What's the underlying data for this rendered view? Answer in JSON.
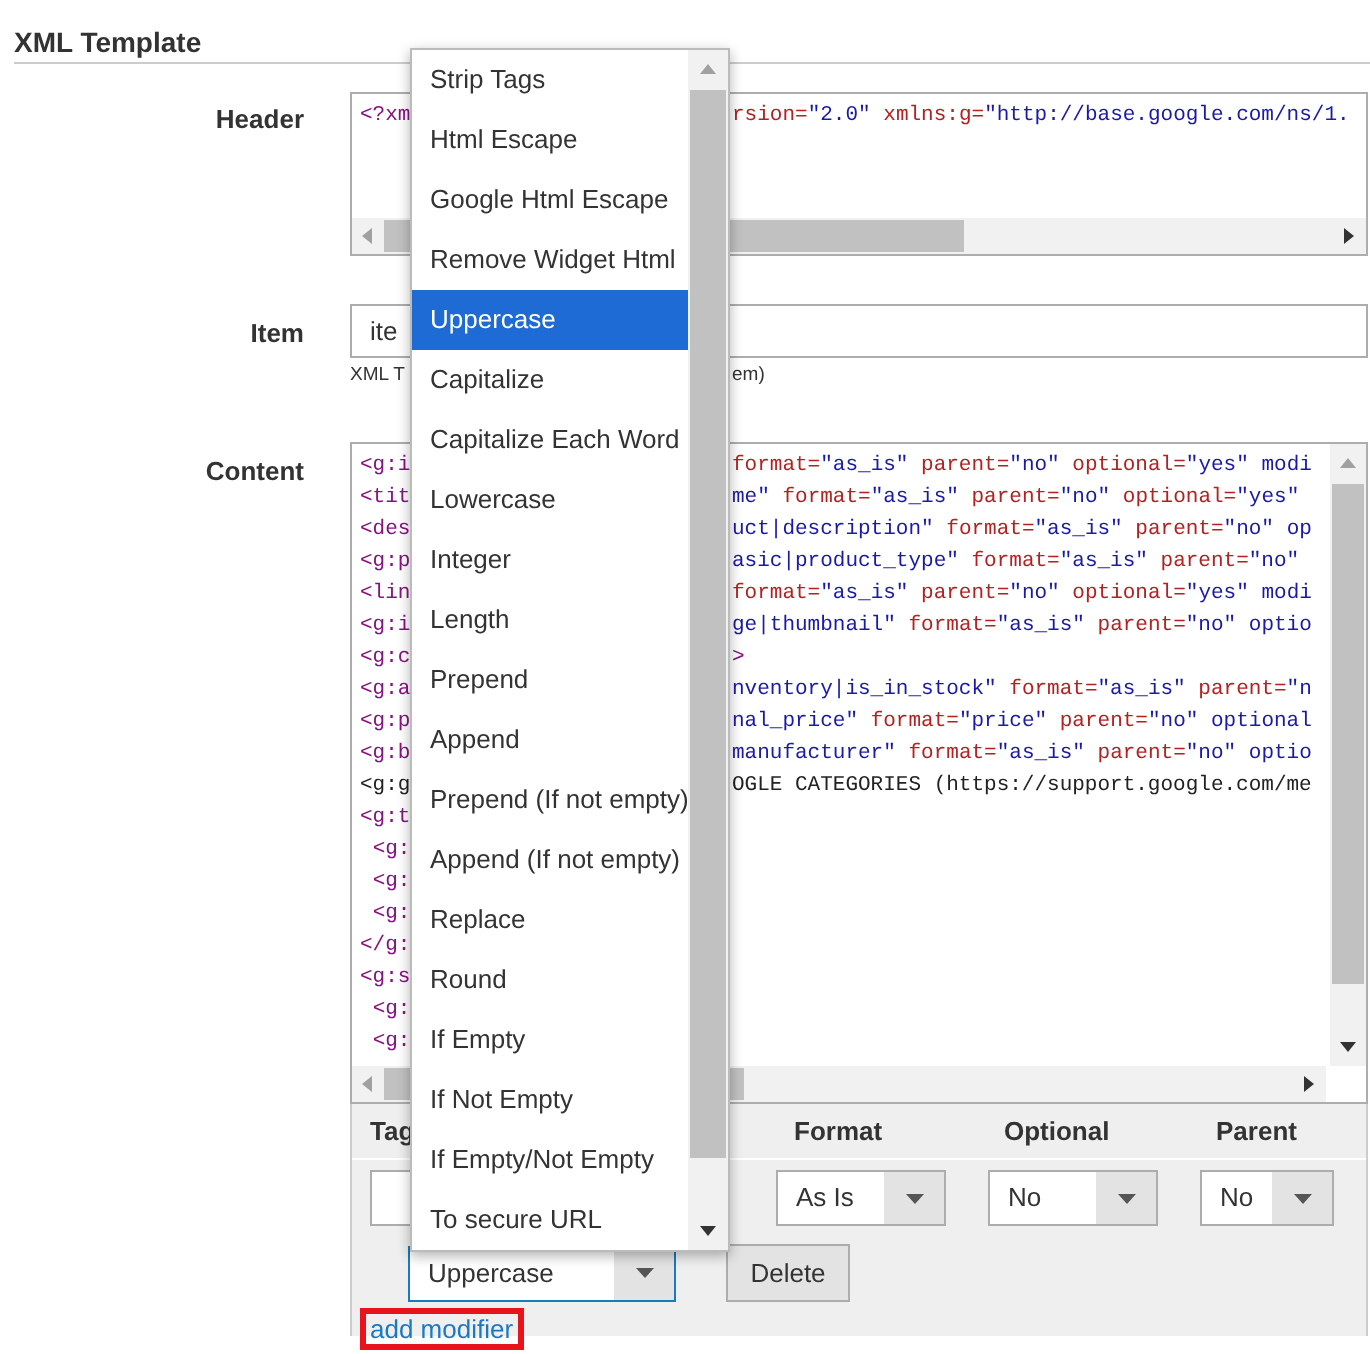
{
  "section": {
    "title": "XML Template"
  },
  "header_field": {
    "label": "Header",
    "line": {
      "left": "<?xm",
      "right": "rsion=\"2.0\" xmlns:g=\"http://base.google.com/ns/1."
    }
  },
  "item_field": {
    "label": "Item",
    "value": "ite",
    "hint_left": "XML T",
    "hint_right": "em)"
  },
  "content_field": {
    "label": "Content",
    "lines": [
      {
        "kind": "code",
        "left": "<g:i",
        "right": "format=\"as_is\" parent=\"no\" optional=\"yes\" modi"
      },
      {
        "kind": "code",
        "left": "<tit",
        "right": "me\" format=\"as_is\" parent=\"no\" optional=\"yes\""
      },
      {
        "kind": "code",
        "left": "<des",
        "right": "uct|description\" format=\"as_is\" parent=\"no\" op"
      },
      {
        "kind": "code",
        "left": "<g:p",
        "right": "asic|product_type\" format=\"as_is\" parent=\"no\""
      },
      {
        "kind": "code",
        "left": "<lin",
        "right": "format=\"as_is\" parent=\"no\" optional=\"yes\" modi"
      },
      {
        "kind": "code",
        "left": "<g:i",
        "right": "ge|thumbnail\" format=\"as_is\" parent=\"no\" optio"
      },
      {
        "kind": "code",
        "left": "<g:c",
        "right": ">"
      },
      {
        "kind": "code",
        "left": "<g:a",
        "right": "nventory|is_in_stock\" format=\"as_is\" parent=\"n"
      },
      {
        "kind": "code",
        "left": "<g:p",
        "right": "nal_price\" format=\"price\" parent=\"no\" optional"
      },
      {
        "kind": "code",
        "left": "<g:b",
        "right": "manufacturer\" format=\"as_is\" parent=\"no\" optio"
      },
      {
        "kind": "comment",
        "left": "<g:g",
        "right": "OGLE CATEGORIES (https://support.google.com/me"
      },
      {
        "kind": "code",
        "left": "<g:t"
      },
      {
        "kind": "code",
        "left": " <g:"
      },
      {
        "kind": "code",
        "left": " <g:"
      },
      {
        "kind": "code",
        "left": " <g:"
      },
      {
        "kind": "code",
        "left": "</g:"
      },
      {
        "kind": "code",
        "left": "<g:s"
      },
      {
        "kind": "code",
        "left": " <g:"
      },
      {
        "kind": "code",
        "left": " <g:"
      }
    ]
  },
  "fields_table": {
    "columns": [
      "Tag",
      "Format",
      "Optional",
      "Parent"
    ],
    "row": {
      "format": "As Is",
      "optional": "No",
      "parent": "No"
    },
    "modifier": {
      "value": "Uppercase",
      "focused": true
    },
    "delete_button": "Delete",
    "add_modifier_link": {
      "label": "add modifier",
      "highlighted": true
    }
  },
  "modifier_dropdown": {
    "items": [
      {
        "label": "Strip Tags",
        "selected": false
      },
      {
        "label": "Html Escape",
        "selected": false
      },
      {
        "label": "Google Html Escape",
        "selected": false
      },
      {
        "label": "Remove Widget Html",
        "selected": false
      },
      {
        "label": "Uppercase",
        "selected": true
      },
      {
        "label": "Capitalize",
        "selected": false
      },
      {
        "label": "Capitalize Each Word",
        "selected": false
      },
      {
        "label": "Lowercase",
        "selected": false
      },
      {
        "label": "Integer",
        "selected": false
      },
      {
        "label": "Length",
        "selected": false
      },
      {
        "label": "Prepend",
        "selected": false
      },
      {
        "label": "Append",
        "selected": false
      },
      {
        "label": "Prepend (If not empty)",
        "selected": false
      },
      {
        "label": "Append (If not empty)",
        "selected": false
      },
      {
        "label": "Replace",
        "selected": false
      },
      {
        "label": "Round",
        "selected": false
      },
      {
        "label": "If Empty",
        "selected": false
      },
      {
        "label": "If Not Empty",
        "selected": false
      },
      {
        "label": "If Empty/Not Empty",
        "selected": false
      },
      {
        "label": "To secure URL",
        "selected": false
      }
    ]
  }
}
